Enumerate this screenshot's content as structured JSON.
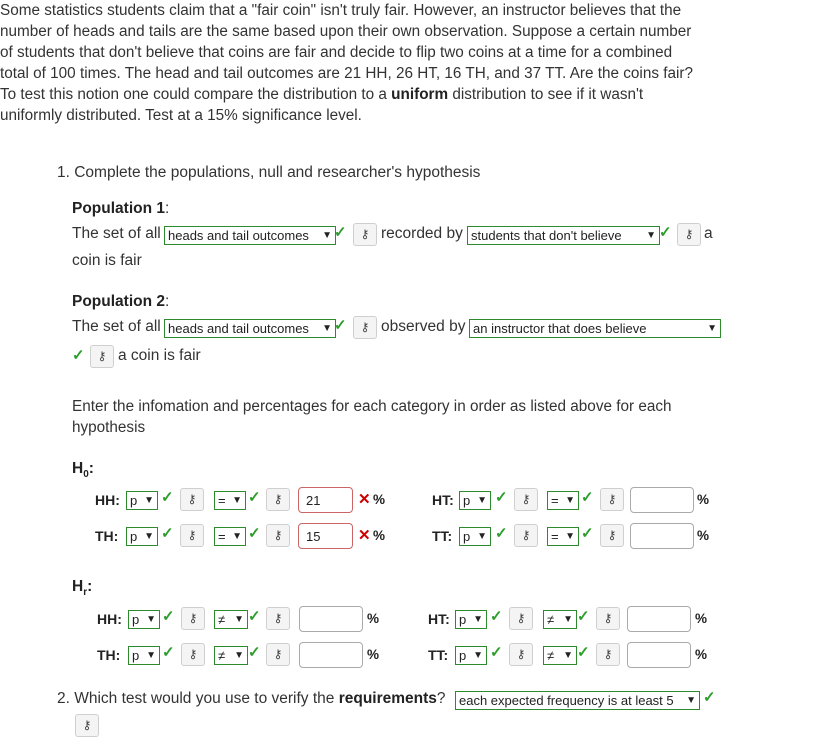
{
  "intro": {
    "text_before": "Some statistics students claim that a \"fair coin\" isn't truly fair. However, an instructor believes that the number of heads and tails are the same based upon their own observation. Suppose a certain number of students that don't believe that coins are fair and decide to flip two coins at a time for a combined total of 100 times. The head and tail outcomes are 21 HH, 26 HT, 16 TH, and 37 TT. Are the coins fair? To test this notion one could compare the distribution to a ",
    "bold_word": "uniform",
    "text_after": " distribution to see if it wasn't uniformly distributed. Test at a 15% significance level."
  },
  "q1": {
    "prompt": "1. Complete the populations, null and researcher's hypothesis",
    "pop1": {
      "heading": "Population 1",
      "colon": ":",
      "prefix": "The set of all",
      "select1": "heads and tail outcomes",
      "middle": "recorded by",
      "select2": "students that don't believe",
      "suffix1": "a",
      "suffix2": "coin is fair"
    },
    "pop2": {
      "heading": "Population 2",
      "colon": ":",
      "prefix": "The set of all",
      "select1": "heads and tail outcomes",
      "middle": "observed by",
      "select2": "an instructor that does believe",
      "suffix": "a coin is fair"
    },
    "instructions": "Enter the infomation and percentages for each category in order as listed above for each hypothesis",
    "h0": {
      "label": "H",
      "sub": "0",
      "colon": ":",
      "rows": [
        {
          "name": "HH:",
          "param": "p",
          "op": "=",
          "value": "21",
          "pct": "%"
        },
        {
          "name": "TH:",
          "param": "p",
          "op": "=",
          "value": "15",
          "pct": "%"
        },
        {
          "name": "HT:",
          "param": "p",
          "op": "=",
          "value": "",
          "pct": "%"
        },
        {
          "name": "TT:",
          "param": "p",
          "op": "=",
          "value": "",
          "pct": "%"
        }
      ]
    },
    "hr": {
      "label": "H",
      "sub": "r",
      "colon": ":",
      "rows": [
        {
          "name": "HH:",
          "param": "p",
          "op": "≠",
          "value": "",
          "pct": "%"
        },
        {
          "name": "TH:",
          "param": "p",
          "op": "≠",
          "value": "",
          "pct": "%"
        },
        {
          "name": "HT:",
          "param": "p",
          "op": "≠",
          "value": "",
          "pct": "%"
        },
        {
          "name": "TT:",
          "param": "p",
          "op": "≠",
          "value": "",
          "pct": "%"
        }
      ]
    }
  },
  "q2": {
    "prompt_before": "2. Which test would you use to verify the ",
    "prompt_bold": "requirements",
    "prompt_after": "?",
    "select": "each expected frequency is at least 5"
  },
  "icons": {
    "key": "key-icon",
    "check": "check-icon",
    "cross": "cross-icon",
    "caret": "chevron-down-icon"
  },
  "colors": {
    "correct": "#2a9d2a",
    "incorrect": "#cc0000"
  }
}
